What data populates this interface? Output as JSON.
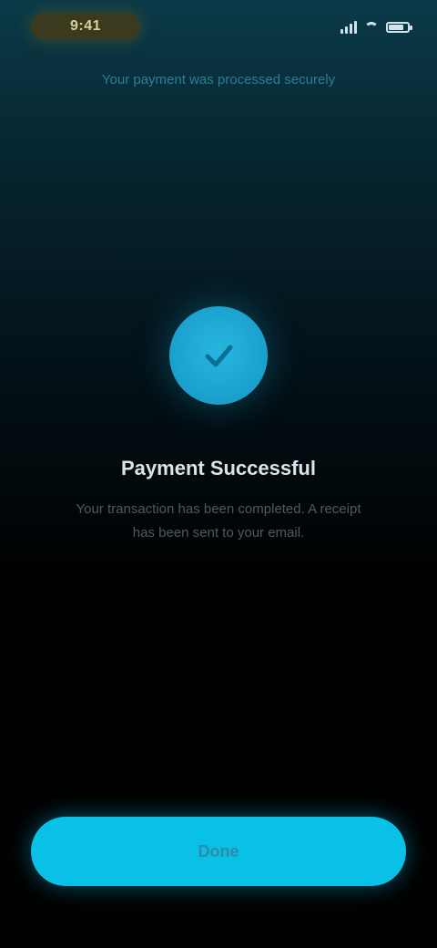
{
  "status_bar": {
    "time": "9:41",
    "battery_level": 0.8,
    "signal_bars": 4
  },
  "banner": {
    "text": "Your payment was processed securely"
  },
  "success": {
    "icon": "checkmark-icon",
    "title": "Payment Successful",
    "description": "Your transaction has been completed. A receipt has been sent to your email."
  },
  "actions": {
    "primary_label": "Done"
  },
  "colors": {
    "accent": "#09c0e6",
    "success_circle": "#1a9fcc",
    "background_top": "#0b3a48",
    "background_bottom": "#000000",
    "status_pill": "#3b3a1f"
  }
}
